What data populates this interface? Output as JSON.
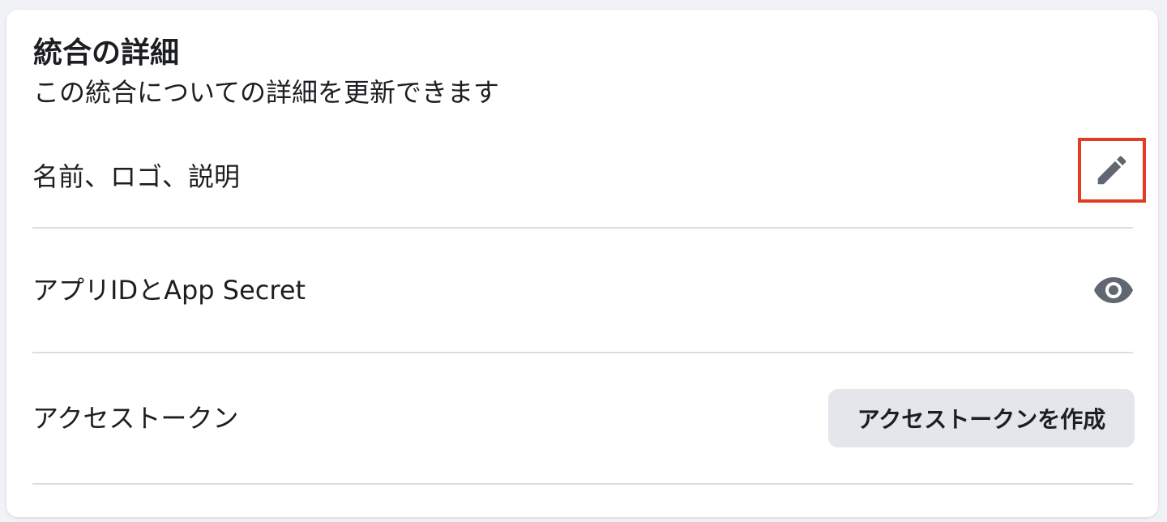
{
  "section": {
    "title": "統合の詳細",
    "subtitle": "この統合についての詳細を更新できます"
  },
  "rows": [
    {
      "label": "名前、ロゴ、説明",
      "action_icon": "pencil-icon"
    },
    {
      "label": "アプリIDとApp Secret",
      "action_icon": "eye-icon"
    },
    {
      "label": "アクセストークン",
      "action_label": "アクセストークンを作成"
    }
  ],
  "colors": {
    "icon": "#606770",
    "highlight": "#e23d24",
    "button_bg": "#e4e6eb",
    "divider": "#dadde1"
  }
}
